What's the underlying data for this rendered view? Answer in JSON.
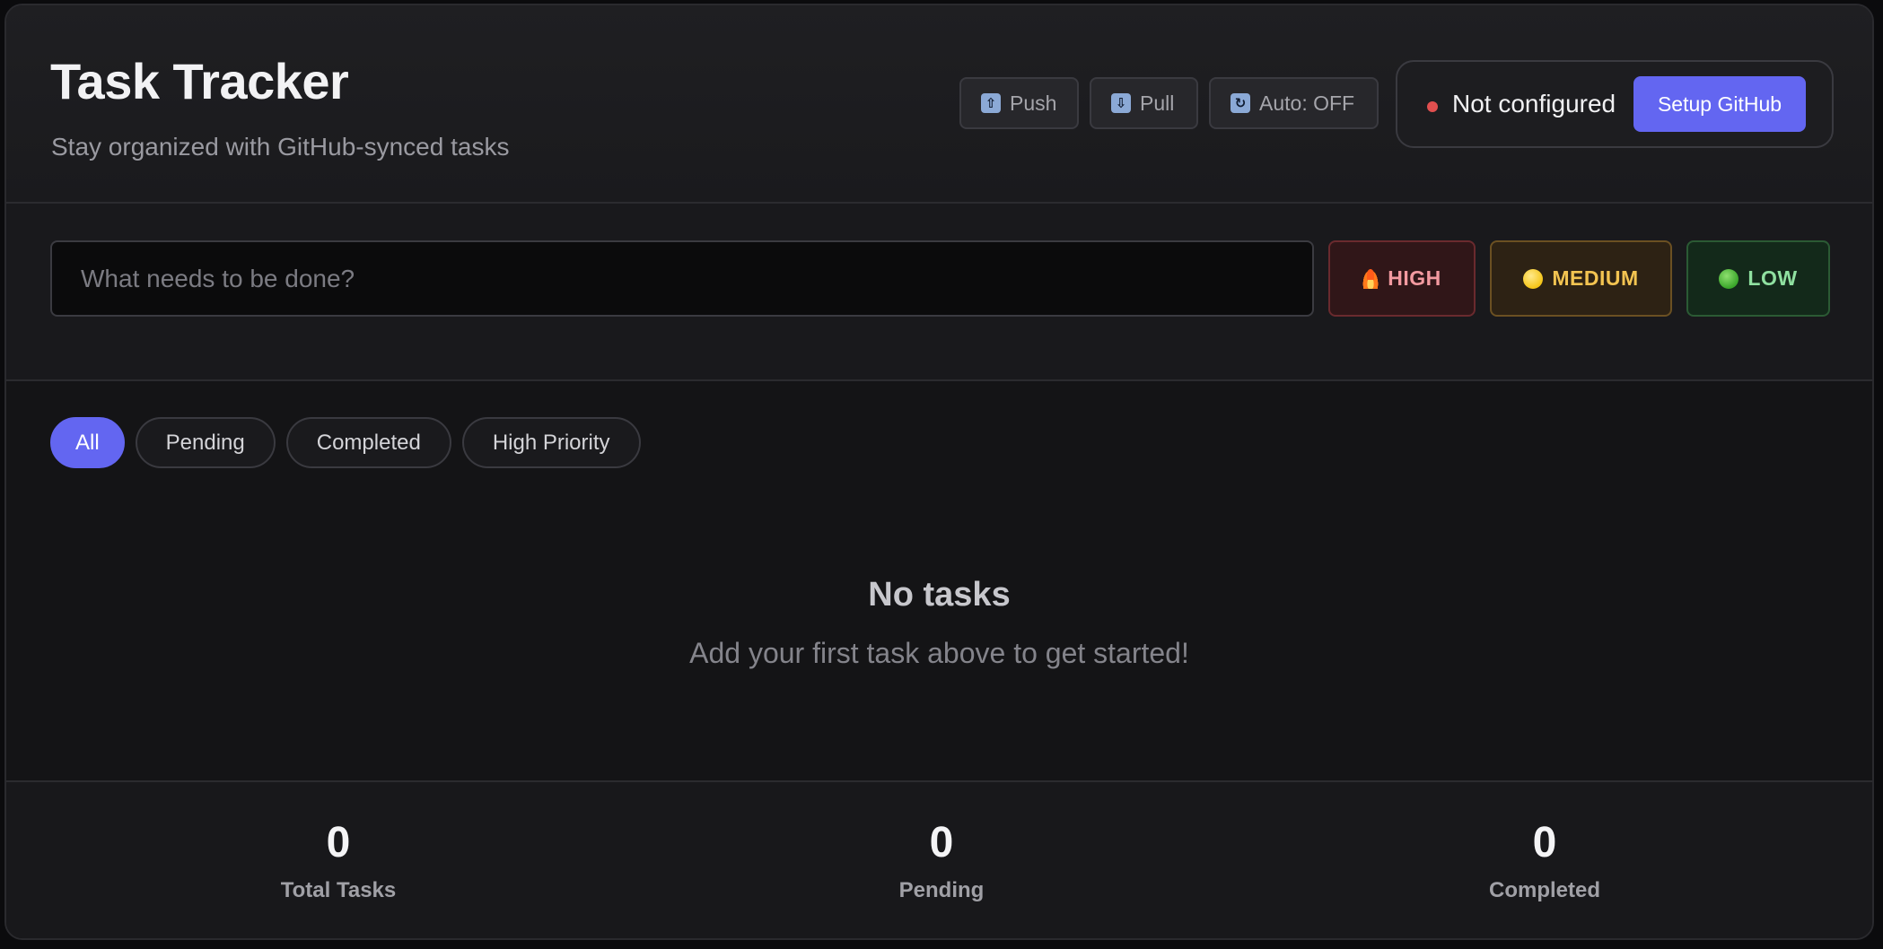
{
  "header": {
    "title": "Task Tracker",
    "subtitle": "Stay organized with GitHub-synced tasks",
    "sync": {
      "push_label": "Push",
      "push_icon": "arrow-up-icon",
      "pull_label": "Pull",
      "pull_icon": "arrow-down-icon",
      "auto_label": "Auto: OFF",
      "auto_icon": "refresh-icon"
    },
    "status": {
      "text": "Not configured",
      "dot_color": "#e14f4f",
      "setup_label": "Setup GitHub"
    }
  },
  "new_task": {
    "placeholder": "What needs to be done?",
    "value": "",
    "priorities": [
      {
        "label": "HIGH",
        "icon": "fire-icon",
        "color": "#f39aa0"
      },
      {
        "label": "MEDIUM",
        "icon": "yellow-circle-icon",
        "color": "#f3c451"
      },
      {
        "label": "LOW",
        "icon": "green-circle-icon",
        "color": "#8fe0a0"
      }
    ]
  },
  "filters": [
    {
      "label": "All",
      "active": true
    },
    {
      "label": "Pending",
      "active": false
    },
    {
      "label": "Completed",
      "active": false
    },
    {
      "label": "High Priority",
      "active": false
    }
  ],
  "empty_state": {
    "title": "No tasks",
    "message": "Add your first task above to get started!"
  },
  "stats": {
    "total": {
      "value": "0",
      "label": "Total Tasks"
    },
    "pending": {
      "value": "0",
      "label": "Pending"
    },
    "completed": {
      "value": "0",
      "label": "Completed"
    }
  },
  "accent_color": "#6366f1"
}
